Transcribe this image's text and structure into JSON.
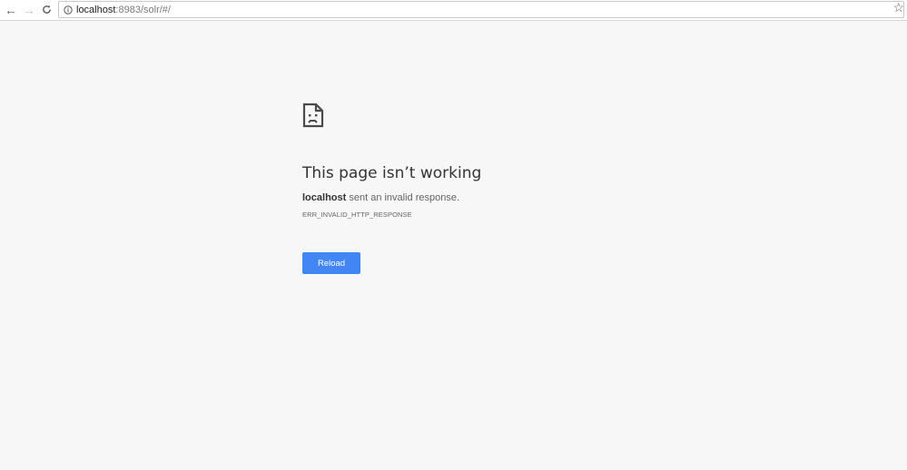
{
  "browser": {
    "back_icon": "arrow-left-icon",
    "forward_icon": "arrow-right-icon",
    "reload_icon": "reload-icon",
    "info_icon": "info-icon",
    "bookmark_icon": "star-icon",
    "url_host": "localhost",
    "url_path": ":8983/solr/#/"
  },
  "error": {
    "icon": "sad-document-icon",
    "title": "This page isn’t working",
    "host": "localhost",
    "message": " sent an invalid response.",
    "code": "ERR_INVALID_HTTP_RESPONSE",
    "reload_label": "Reload",
    "button_color": "#4285f4"
  }
}
